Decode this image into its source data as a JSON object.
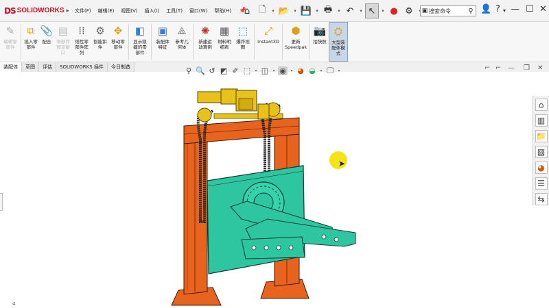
{
  "app": {
    "logo_prefix": "DS",
    "logo_text": "SOLIDWORKS"
  },
  "menu": [
    {
      "label": "文件(F)"
    },
    {
      "label": "编辑(E)"
    },
    {
      "label": "视图(V)"
    },
    {
      "label": "插入(I)"
    },
    {
      "label": "工具(T)"
    },
    {
      "label": "窗口(W)"
    },
    {
      "label": "帮助(H)"
    }
  ],
  "search": {
    "placeholder": "搜索命令"
  },
  "ribbon": {
    "buttons": [
      {
        "label": "编辑零\n部件",
        "icon": "edit-component-icon",
        "disabled": true
      },
      {
        "label": "插入零\n部件",
        "icon": "insert-components-icon",
        "disabled": false
      },
      {
        "label": "配合",
        "icon": "mate-icon",
        "disabled": false
      },
      {
        "label": "零部件\n预览窗\n口",
        "icon": "component-preview-icon",
        "disabled": true
      },
      {
        "label": "线性零\n部件阵\n列",
        "icon": "linear-pattern-icon",
        "disabled": false
      },
      {
        "label": "智能扣\n件",
        "icon": "smart-fasteners-icon",
        "disabled": false
      },
      {
        "label": "移动零\n部件",
        "icon": "move-component-icon",
        "disabled": false
      },
      {
        "label": "显示隐\n藏的零\n部件",
        "icon": "show-hidden-icon",
        "disabled": false
      },
      {
        "label": "装配体\n特征",
        "icon": "assembly-features-icon",
        "disabled": false
      },
      {
        "label": "参考几\n何体",
        "icon": "reference-geometry-icon",
        "disabled": false
      },
      {
        "label": "新建运\n动算例",
        "icon": "motion-study-icon",
        "disabled": false
      },
      {
        "label": "材料明\n细表",
        "icon": "bill-of-materials-icon",
        "disabled": false
      },
      {
        "label": "爆炸视\n图",
        "icon": "exploded-view-icon",
        "disabled": false
      },
      {
        "label": "Instant3D",
        "icon": "instant3d-icon",
        "disabled": false
      },
      {
        "label": "更新\nSpeedpak",
        "icon": "speedpak-icon",
        "disabled": false
      },
      {
        "label": "拍快照",
        "icon": "snapshot-icon",
        "disabled": false
      },
      {
        "label": "大型装\n配体模\n式",
        "icon": "large-assembly-icon",
        "disabled": false,
        "active": true
      }
    ]
  },
  "tabs": [
    {
      "label": "装配体",
      "active": true
    },
    {
      "label": "草图",
      "active": false
    },
    {
      "label": "评估",
      "active": false
    },
    {
      "label": "SOLIDWORKS 插件",
      "active": false
    },
    {
      "label": "今日制造",
      "active": false
    }
  ],
  "viewport": {
    "corner_text": "4"
  },
  "colors": {
    "frame": "#e8641e",
    "plate": "#2ec6a0",
    "motor": "#e8c21a",
    "chain": "#2a2a2a",
    "cursor_highlight": "#f4e20c",
    "brand": "#c8102e"
  }
}
